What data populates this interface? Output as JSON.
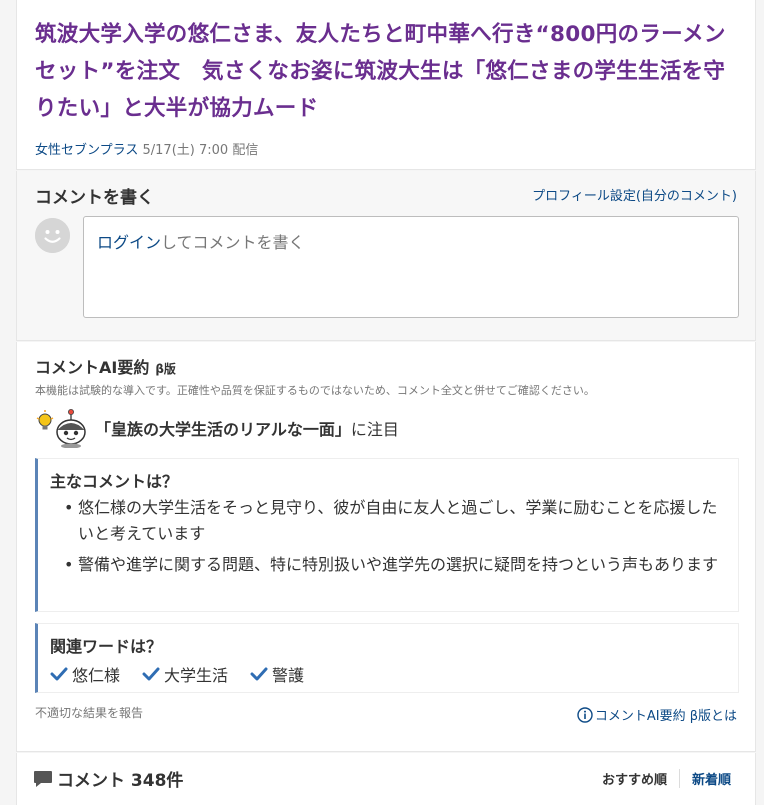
{
  "article": {
    "headline": "筑波大学入学の悠仁さま、友人たちと町中華へ行き“800円のラーメンセット”を注文　気さくなお姿に筑波大生は「悠仁さまの学生生活を守りたい」と大半が協力ムード",
    "source": "女性セブンプラス",
    "date": "5/17(土) 7:00",
    "tag": "配信"
  },
  "comment_write": {
    "title": "コメントを書く",
    "profile_link": "プロフィール設定(自分のコメント)",
    "login_label": "ログイン",
    "prompt_rest": "してコメントを書く"
  },
  "ai_summary": {
    "title": "コメントAI要約",
    "beta": "β版",
    "disclaimer": "本機能は試験的な導入です。正確性や品質を保証するものではないため、コメント全文と併せてご確認ください。",
    "focus_quote": "「皇族の大学生活のリアルな一面」",
    "focus_suffix": "に注目",
    "main_title": "主なコメントは？",
    "main_points": [
      "悠仁様の大学生活をそっと見守り、彼が自由に友人と過ごし、学業に励むことを応援したいと考えています",
      "警備や進学に関する問題、特に特別扱いや進学先の選択に疑問を持つという声もあります"
    ],
    "words_title": "関連ワードは？",
    "words": [
      "悠仁様",
      "大学生活",
      "警護"
    ],
    "report_link": "不適切な結果を報告",
    "about_link": "コメントAI要約 β版とは"
  },
  "comments_bar": {
    "title": "コメント 348件",
    "sort_recommended": "おすすめ順",
    "sort_newest": "新着順"
  },
  "colors": {
    "headline": "#6a2e8f",
    "link": "#0d4a86",
    "box_accent": "#5b84b7",
    "check": "#2f6db3"
  }
}
